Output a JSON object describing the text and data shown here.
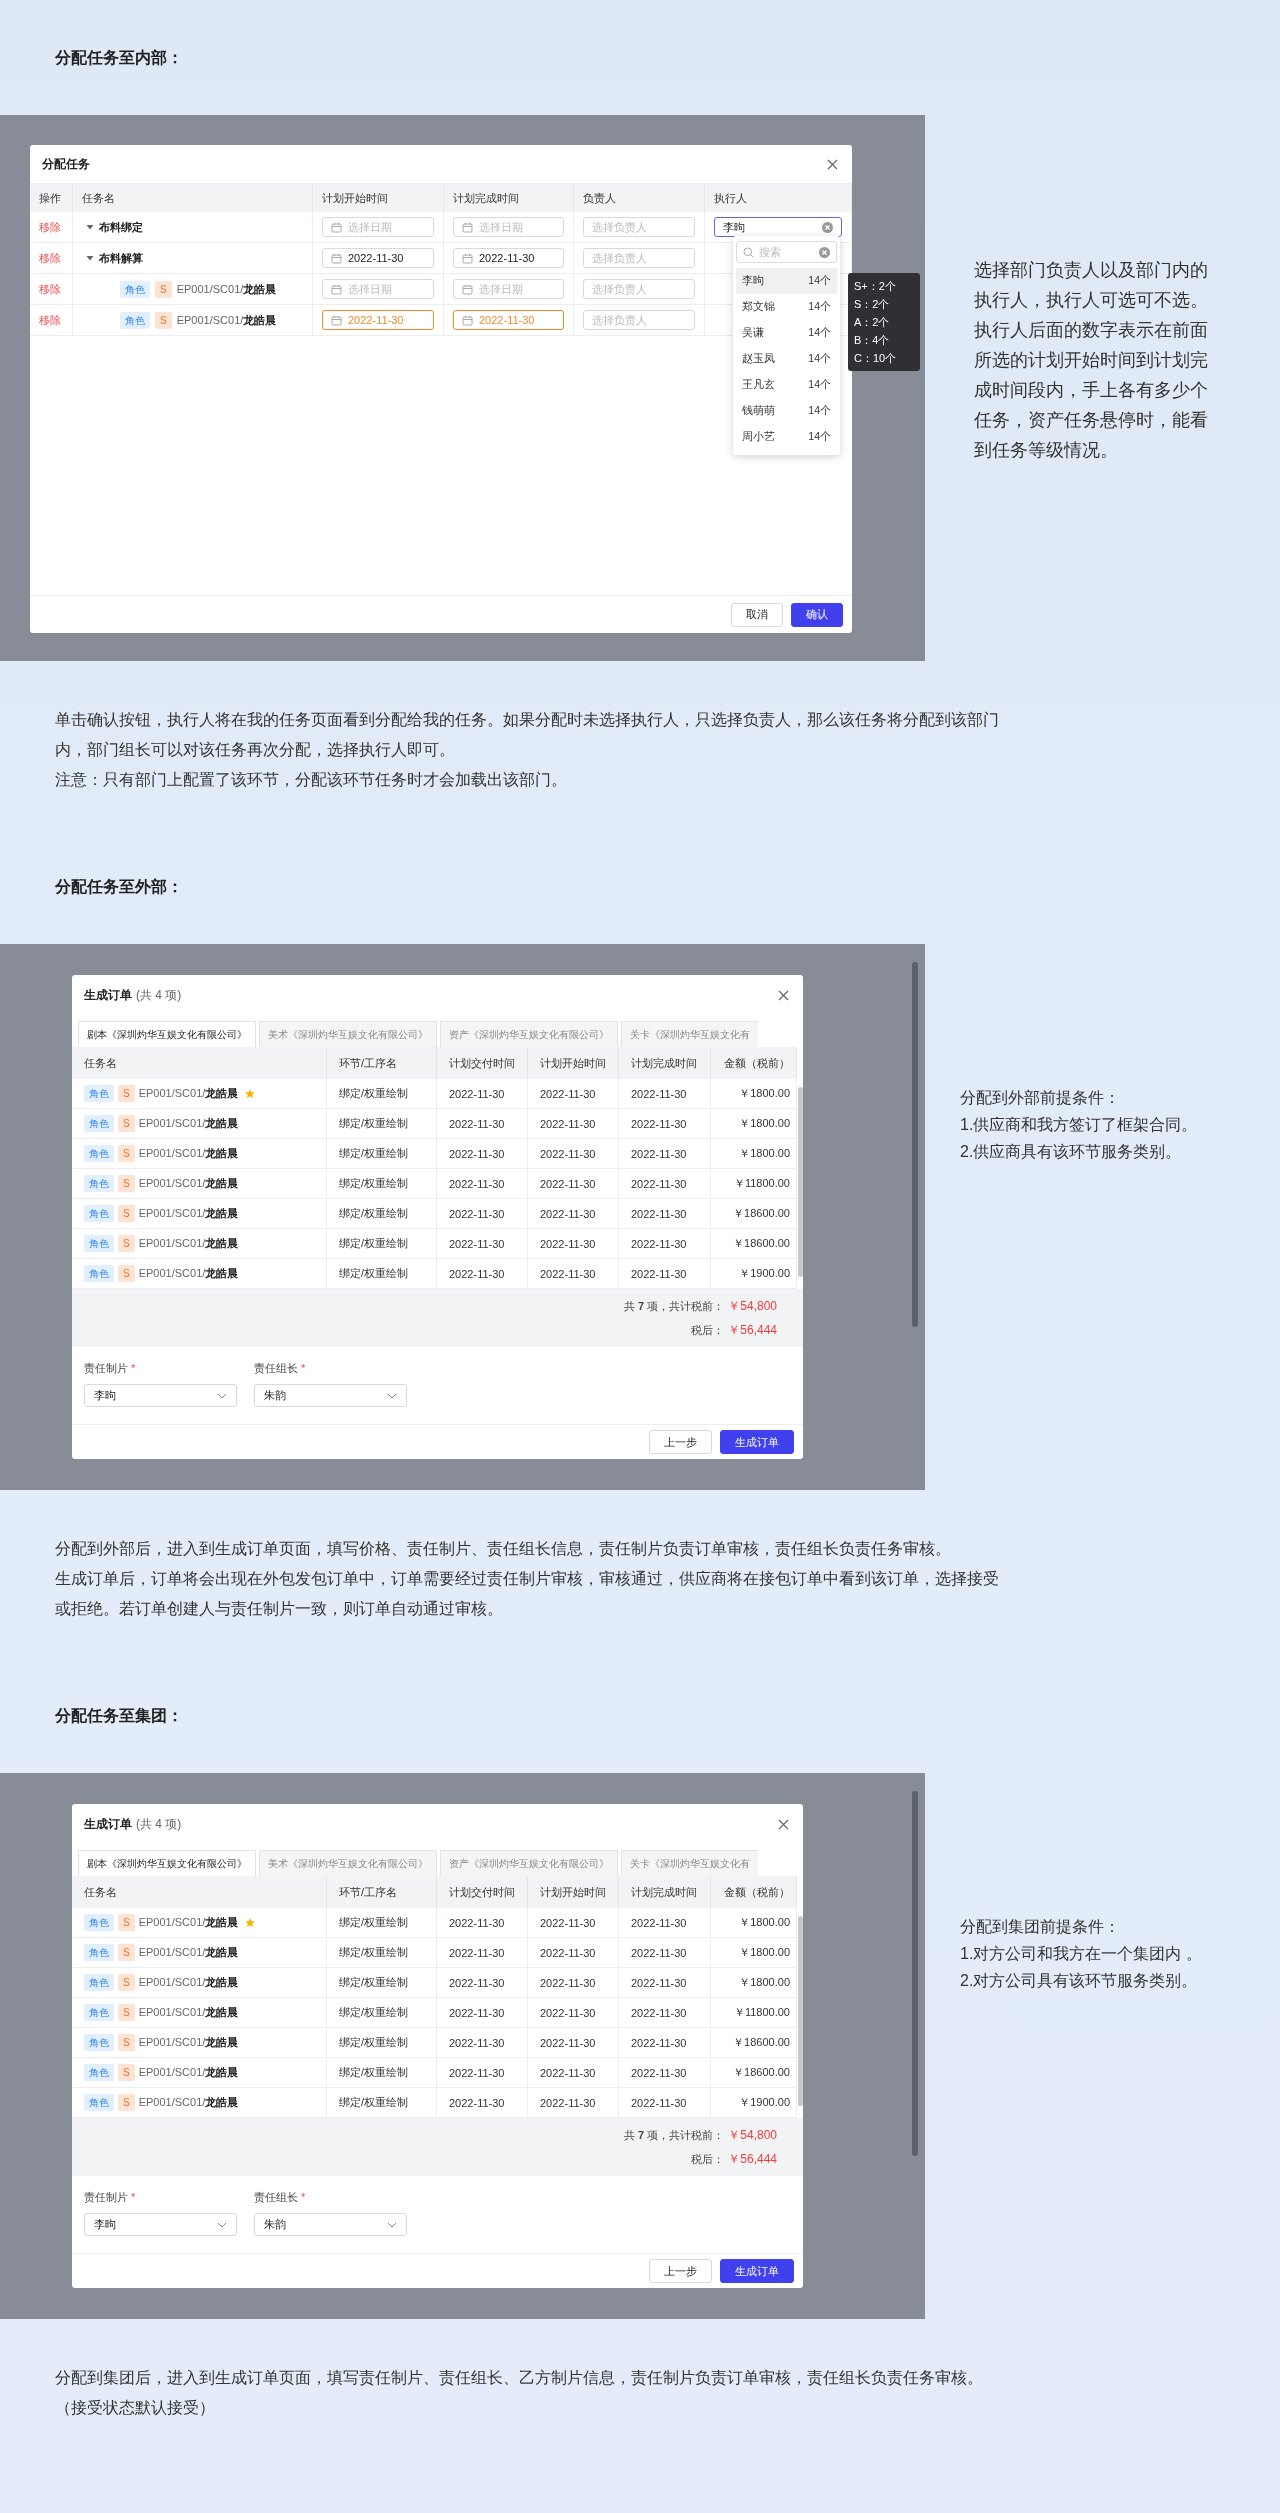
{
  "sections": [
    {
      "kind": "assign",
      "heading": "分配任务至内部：",
      "dialog": {
        "title": "分配任务",
        "columns": [
          "操作",
          "任务名",
          "计划开始时间",
          "计划完成时间",
          "负责人",
          "执行人"
        ],
        "rows": [
          {
            "kind": "group",
            "action": "移除",
            "expanded": true,
            "name": "布料绑定",
            "start": {
              "placeholder": "选择日期",
              "warning": false
            },
            "end": {
              "placeholder": "选择日期",
              "warning": false
            },
            "owner": {
              "placeholder": "选择负责人"
            },
            "executor": {
              "value": "李昫",
              "focused": true
            }
          },
          {
            "kind": "group",
            "action": "移除",
            "expanded": true,
            "name": "布料解算",
            "start": {
              "value": "2022-11-30",
              "warning": false
            },
            "end": {
              "value": "2022-11-30",
              "warning": false
            },
            "owner": {
              "placeholder": "选择负责人"
            }
          },
          {
            "kind": "task",
            "action": "移除",
            "tags": [
              {
                "text": "角色",
                "kind": "category"
              },
              {
                "text": "S",
                "kind": "grade"
              }
            ],
            "path": "EP001/SC01/",
            "name": "龙皓晨",
            "start": {
              "placeholder": "选择日期",
              "warning": false
            },
            "end": {
              "placeholder": "选择日期",
              "warning": false
            },
            "owner": {
              "placeholder": "选择负责人"
            }
          },
          {
            "kind": "task",
            "action": "移除",
            "tags": [
              {
                "text": "角色",
                "kind": "category"
              },
              {
                "text": "S",
                "kind": "grade"
              }
            ],
            "path": "EP001/SC01/",
            "name": "龙皓晨",
            "start": {
              "value": "2022-11-30",
              "warning": true
            },
            "end": {
              "value": "2022-11-30",
              "warning": true
            },
            "owner": {
              "placeholder": "选择负责人"
            }
          }
        ],
        "dropdown": {
          "placeholder": "搜索",
          "options": [
            {
              "name": "李昫",
              "count": "14个",
              "selected": true
            },
            {
              "name": "郑文锦",
              "count": "14个",
              "selected": false
            },
            {
              "name": "吴谦",
              "count": "14个",
              "selected": false
            },
            {
              "name": "赵玉凤",
              "count": "14个",
              "selected": false
            },
            {
              "name": "王凡玄",
              "count": "14个",
              "selected": false
            },
            {
              "name": "钱萌萌",
              "count": "14个",
              "selected": false
            },
            {
              "name": "周小艺",
              "count": "14个",
              "selected": false
            }
          ]
        },
        "tooltip": [
          "S+：2个",
          "S：2个",
          "A：2个",
          "B：4个",
          "C：10个"
        ],
        "buttons": [
          {
            "label": "取消",
            "kind": "secondary"
          },
          {
            "label": "确认",
            "kind": "primary"
          }
        ]
      },
      "note": [
        "选择部门负责人以及部门内的执行人，执行人可选可不选。执行人后面的数字表示在前面所选的计划开始时间到计划完成时间段内，手上各有多少个任务，资产任务悬停时，能看到任务等级情况。"
      ],
      "paragraph": [
        "单击确认按钮，执行人将在我的任务页面看到分配给我的任务。如果分配时未选择执行人，只选择负责人，那么该任务将分配到该部门",
        "内，部门组长可以对该任务再次分配，选择执行人即可。",
        "注意：只有部门上配置了该环节，分配该环节任务时才会加载出该部门。"
      ]
    },
    {
      "kind": "order",
      "heading": "分配任务至外部：",
      "dialog": {
        "title": "生成订单",
        "count": "(共 4 项)",
        "tabs": [
          {
            "label": "剧本《深圳灼华互娱文化有限公司》",
            "selected": true
          },
          {
            "label": "美术《深圳灼华互娱文化有限公司》",
            "selected": false
          },
          {
            "label": "资产《深圳灼华互娱文化有限公司》",
            "selected": false
          },
          {
            "label": "关卡《深圳灼华互娱文化有",
            "selected": false
          }
        ],
        "columns": [
          "任务名",
          "环节/工序名",
          "计划交付时间",
          "计划开始时间",
          "计划完成时间",
          "金额（税前）"
        ],
        "rows": [
          {
            "tags": [
              {
                "text": "角色",
                "kind": "category"
              },
              {
                "text": "S",
                "kind": "grade"
              }
            ],
            "path": "EP001/SC01/",
            "name": "龙皓晨",
            "starred": true,
            "step": "绑定/权重绘制",
            "delivery": "2022-11-30",
            "start": "2022-11-30",
            "end": "2022-11-30",
            "amount": "￥1800.00"
          },
          {
            "tags": [
              {
                "text": "角色",
                "kind": "category"
              },
              {
                "text": "S",
                "kind": "grade"
              }
            ],
            "path": "EP001/SC01/",
            "name": "龙皓晨",
            "starred": false,
            "step": "绑定/权重绘制",
            "delivery": "2022-11-30",
            "start": "2022-11-30",
            "end": "2022-11-30",
            "amount": "￥1800.00"
          },
          {
            "tags": [
              {
                "text": "角色",
                "kind": "category"
              },
              {
                "text": "S",
                "kind": "grade"
              }
            ],
            "path": "EP001/SC01/",
            "name": "龙皓晨",
            "starred": false,
            "step": "绑定/权重绘制",
            "delivery": "2022-11-30",
            "start": "2022-11-30",
            "end": "2022-11-30",
            "amount": "￥1800.00"
          },
          {
            "tags": [
              {
                "text": "角色",
                "kind": "category"
              },
              {
                "text": "S",
                "kind": "grade"
              }
            ],
            "path": "EP001/SC01/",
            "name": "龙皓晨",
            "starred": false,
            "step": "绑定/权重绘制",
            "delivery": "2022-11-30",
            "start": "2022-11-30",
            "end": "2022-11-30",
            "amount": "￥11800.00"
          },
          {
            "tags": [
              {
                "text": "角色",
                "kind": "category"
              },
              {
                "text": "S",
                "kind": "grade"
              }
            ],
            "path": "EP001/SC01/",
            "name": "龙皓晨",
            "starred": false,
            "step": "绑定/权重绘制",
            "delivery": "2022-11-30",
            "start": "2022-11-30",
            "end": "2022-11-30",
            "amount": "￥18600.00"
          },
          {
            "tags": [
              {
                "text": "角色",
                "kind": "category"
              },
              {
                "text": "S",
                "kind": "grade"
              }
            ],
            "path": "EP001/SC01/",
            "name": "龙皓晨",
            "starred": false,
            "step": "绑定/权重绘制",
            "delivery": "2022-11-30",
            "start": "2022-11-30",
            "end": "2022-11-30",
            "amount": "￥18600.00"
          },
          {
            "tags": [
              {
                "text": "角色",
                "kind": "category"
              },
              {
                "text": "S",
                "kind": "grade"
              }
            ],
            "path": "EP001/SC01/",
            "name": "龙皓晨",
            "starred": false,
            "step": "绑定/权重绘制",
            "delivery": "2022-11-30",
            "start": "2022-11-30",
            "end": "2022-11-30",
            "amount": "￥1900.00"
          }
        ],
        "summary": {
          "count_text": "共 **7** 项，共计税前：",
          "pre_tax": "￥54,800",
          "after_label": "税后：",
          "after_tax": "￥56,444"
        },
        "fields": [
          {
            "label": "责任制片",
            "required_mark": "*",
            "value": "李昫"
          },
          {
            "label": "责任组长",
            "required_mark": "*",
            "value": "朱韵"
          }
        ],
        "buttons": [
          {
            "label": "上一步",
            "kind": "secondary"
          },
          {
            "label": "生成订单",
            "kind": "primary"
          }
        ]
      },
      "note": [
        "分配到外部前提条件：",
        "1.供应商和我方签订了框架合同。",
        "2.供应商具有该环节服务类别。"
      ],
      "paragraph": [
        "分配到外部后，进入到生成订单页面，填写价格、责任制片、责任组长信息，责任制片负责订单审核，责任组长负责任务审核。",
        "生成订单后，订单将会出现在外包发包订单中，订单需要经过责任制片审核，审核通过，供应商将在接包订单中看到该订单，选择接受",
        "或拒绝。若订单创建人与责任制片一致，则订单自动通过审核。"
      ]
    },
    {
      "kind": "order",
      "heading": "分配任务至集团：",
      "dialog": {
        "title": "生成订单",
        "count": "(共 4 项)",
        "tabs": [
          {
            "label": "剧本《深圳灼华互娱文化有限公司》",
            "selected": true
          },
          {
            "label": "美术《深圳灼华互娱文化有限公司》",
            "selected": false
          },
          {
            "label": "资产《深圳灼华互娱文化有限公司》",
            "selected": false
          },
          {
            "label": "关卡《深圳灼华互娱文化有",
            "selected": false
          }
        ],
        "columns": [
          "任务名",
          "环节/工序名",
          "计划交付时间",
          "计划开始时间",
          "计划完成时间",
          "金额（税前）"
        ],
        "rows": [
          {
            "tags": [
              {
                "text": "角色",
                "kind": "category"
              },
              {
                "text": "S",
                "kind": "grade"
              }
            ],
            "path": "EP001/SC01/",
            "name": "龙皓晨",
            "starred": true,
            "step": "绑定/权重绘制",
            "delivery": "2022-11-30",
            "start": "2022-11-30",
            "end": "2022-11-30",
            "amount": "￥1800.00"
          },
          {
            "tags": [
              {
                "text": "角色",
                "kind": "category"
              },
              {
                "text": "S",
                "kind": "grade"
              }
            ],
            "path": "EP001/SC01/",
            "name": "龙皓晨",
            "starred": false,
            "step": "绑定/权重绘制",
            "delivery": "2022-11-30",
            "start": "2022-11-30",
            "end": "2022-11-30",
            "amount": "￥1800.00"
          },
          {
            "tags": [
              {
                "text": "角色",
                "kind": "category"
              },
              {
                "text": "S",
                "kind": "grade"
              }
            ],
            "path": "EP001/SC01/",
            "name": "龙皓晨",
            "starred": false,
            "step": "绑定/权重绘制",
            "delivery": "2022-11-30",
            "start": "2022-11-30",
            "end": "2022-11-30",
            "amount": "￥1800.00"
          },
          {
            "tags": [
              {
                "text": "角色",
                "kind": "category"
              },
              {
                "text": "S",
                "kind": "grade"
              }
            ],
            "path": "EP001/SC01/",
            "name": "龙皓晨",
            "starred": false,
            "step": "绑定/权重绘制",
            "delivery": "2022-11-30",
            "start": "2022-11-30",
            "end": "2022-11-30",
            "amount": "￥11800.00"
          },
          {
            "tags": [
              {
                "text": "角色",
                "kind": "category"
              },
              {
                "text": "S",
                "kind": "grade"
              }
            ],
            "path": "EP001/SC01/",
            "name": "龙皓晨",
            "starred": false,
            "step": "绑定/权重绘制",
            "delivery": "2022-11-30",
            "start": "2022-11-30",
            "end": "2022-11-30",
            "amount": "￥18600.00"
          },
          {
            "tags": [
              {
                "text": "角色",
                "kind": "category"
              },
              {
                "text": "S",
                "kind": "grade"
              }
            ],
            "path": "EP001/SC01/",
            "name": "龙皓晨",
            "starred": false,
            "step": "绑定/权重绘制",
            "delivery": "2022-11-30",
            "start": "2022-11-30",
            "end": "2022-11-30",
            "amount": "￥18600.00"
          },
          {
            "tags": [
              {
                "text": "角色",
                "kind": "category"
              },
              {
                "text": "S",
                "kind": "grade"
              }
            ],
            "path": "EP001/SC01/",
            "name": "龙皓晨",
            "starred": false,
            "step": "绑定/权重绘制",
            "delivery": "2022-11-30",
            "start": "2022-11-30",
            "end": "2022-11-30",
            "amount": "￥1900.00"
          }
        ],
        "summary": {
          "count_text": "共 **7** 项，共计税前：",
          "pre_tax": "￥54,800",
          "after_label": "税后：",
          "after_tax": "￥56,444"
        },
        "fields": [
          {
            "label": "责任制片",
            "required_mark": "*",
            "value": "李昫"
          },
          {
            "label": "责任组长",
            "required_mark": "*",
            "value": "朱韵"
          }
        ],
        "buttons": [
          {
            "label": "上一步",
            "kind": "secondary"
          },
          {
            "label": "生成订单",
            "kind": "primary"
          }
        ]
      },
      "note": [
        "分配到集团前提条件：",
        "1.对方公司和我方在一个集团内 。",
        "2.对方公司具有该环节服务类别。"
      ],
      "paragraph": [
        "分配到集团后，进入到生成订单页面，填写责任制片、责任组长、乙方制片信息，责任制片负责订单审核，责任组长负责任务审核。",
        "（接受状态默认接受）"
      ]
    }
  ]
}
